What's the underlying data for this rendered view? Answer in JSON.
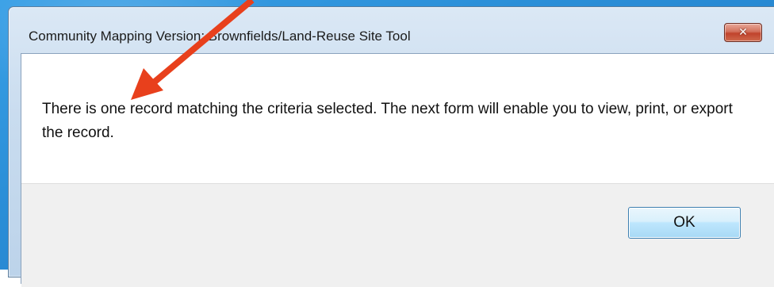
{
  "dialog": {
    "title": "Community Mapping Version: Brownfields/Land-Reuse Site Tool",
    "close_icon": "close-icon",
    "close_glyph": "✕",
    "message": "There is one record matching the criteria selected. The next form will enable you to view, print, or export the record.",
    "ok_label": "OK"
  },
  "annotation": {
    "arrow_color": "#e8401c"
  },
  "colors": {
    "desktop": "#2b8fd8",
    "close_button": "#c0432c",
    "ok_button_border": "#3c7fb1"
  }
}
